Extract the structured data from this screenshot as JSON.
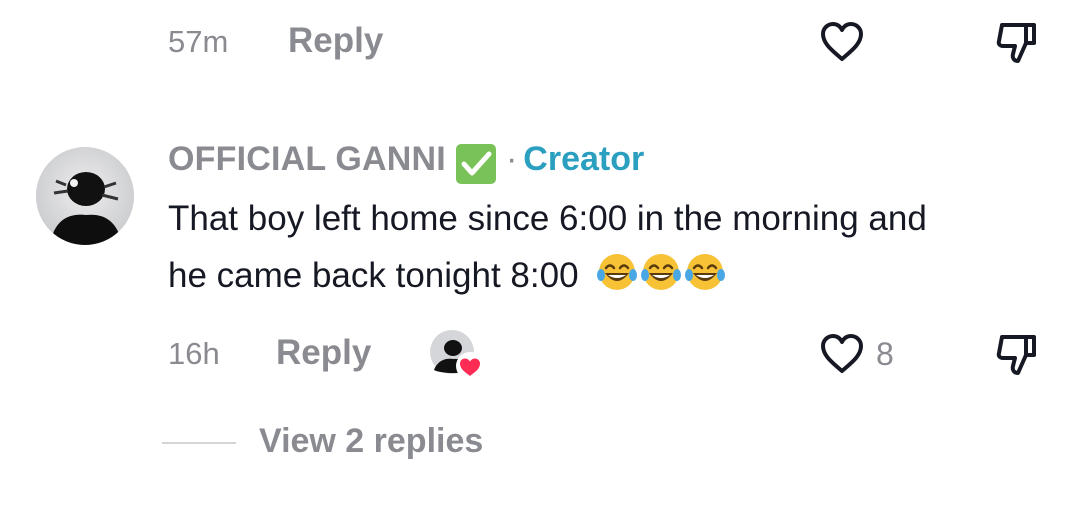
{
  "previous_comment": {
    "timestamp": "57m",
    "reply_label": "Reply",
    "like_icon": "heart-outline-icon",
    "dislike_icon": "thumbs-down-icon"
  },
  "comment": {
    "username": "OFFICIAL GANNI",
    "verified_icon": "green-check-box-icon",
    "separator": "·",
    "badge": "Creator",
    "text_line1": "That boy left home since 6:00 in the morning and",
    "text_line2": "he came back tonight 8:00",
    "emojis": [
      "face-with-tears-of-joy",
      "face-with-tears-of-joy",
      "face-with-tears-of-joy"
    ],
    "timestamp": "16h",
    "reply_label": "Reply",
    "like_count": "8",
    "like_icon": "heart-outline-icon",
    "dislike_icon": "thumbs-down-icon",
    "creator_liked_icon": "avatar-with-red-heart-icon"
  },
  "view_replies_label": "View 2 replies",
  "colors": {
    "muted": "#8a8b91",
    "creator_badge": "#2a9fbf",
    "verified": "#78c257",
    "heart_red": "#fe2c55"
  }
}
